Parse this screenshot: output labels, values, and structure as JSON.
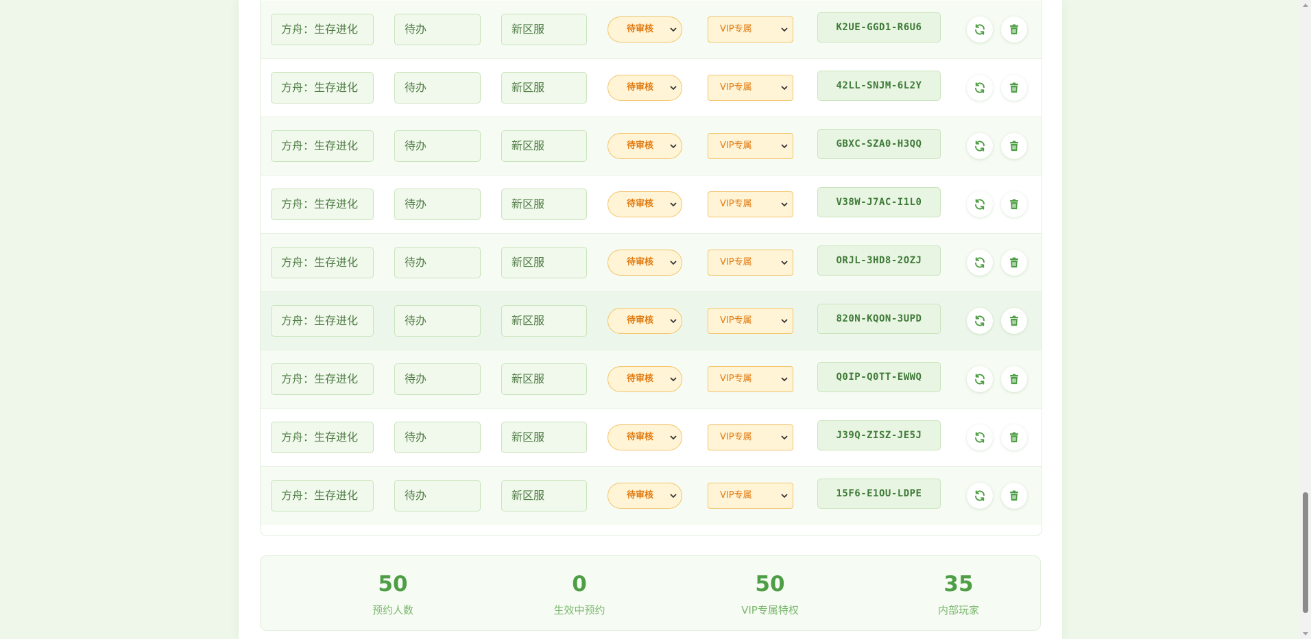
{
  "rows": [
    {
      "name": "方舟：生存进化",
      "status": "待办",
      "server": "新区服",
      "review": "待审核",
      "tier": "VIP专属",
      "code": "K2UE-GGD1-R6U6"
    },
    {
      "name": "方舟：生存进化",
      "status": "待办",
      "server": "新区服",
      "review": "待审核",
      "tier": "VIP专属",
      "code": "42LL-SNJM-6L2Y"
    },
    {
      "name": "方舟：生存进化",
      "status": "待办",
      "server": "新区服",
      "review": "待审核",
      "tier": "VIP专属",
      "code": "GBXC-SZA0-H3QQ"
    },
    {
      "name": "方舟：生存进化",
      "status": "待办",
      "server": "新区服",
      "review": "待审核",
      "tier": "VIP专属",
      "code": "V38W-J7AC-I1L0"
    },
    {
      "name": "方舟：生存进化",
      "status": "待办",
      "server": "新区服",
      "review": "待审核",
      "tier": "VIP专属",
      "code": "ORJL-3HD8-2OZJ"
    },
    {
      "name": "方舟：生存进化",
      "status": "待办",
      "server": "新区服",
      "review": "待审核",
      "tier": "VIP专属",
      "code": "820N-KQON-3UPD"
    },
    {
      "name": "方舟：生存进化",
      "status": "待办",
      "server": "新区服",
      "review": "待审核",
      "tier": "VIP专属",
      "code": "Q0IP-Q0TT-EWWQ"
    },
    {
      "name": "方舟：生存进化",
      "status": "待办",
      "server": "新区服",
      "review": "待审核",
      "tier": "VIP专属",
      "code": "J39Q-ZISZ-JE5J"
    },
    {
      "name": "方舟：生存进化",
      "status": "待办",
      "server": "新区服",
      "review": "待审核",
      "tier": "VIP专属",
      "code": "15F6-E1OU-LDPE"
    }
  ],
  "actions": {
    "refresh_icon": "refresh-icon",
    "delete_icon": "trash-icon"
  },
  "stats": [
    {
      "value": "50",
      "label": "预约人数"
    },
    {
      "value": "0",
      "label": "生效中预约"
    },
    {
      "value": "50",
      "label": "VIP专属特权"
    },
    {
      "value": "35",
      "label": "内部玩家"
    }
  ],
  "colors": {
    "accent_green": "#4e9e45",
    "light_green": "#f1f8ec",
    "warning_orange": "#e07a10",
    "warning_bg": "#fff4d6",
    "page_bg": "#eef7ea"
  }
}
